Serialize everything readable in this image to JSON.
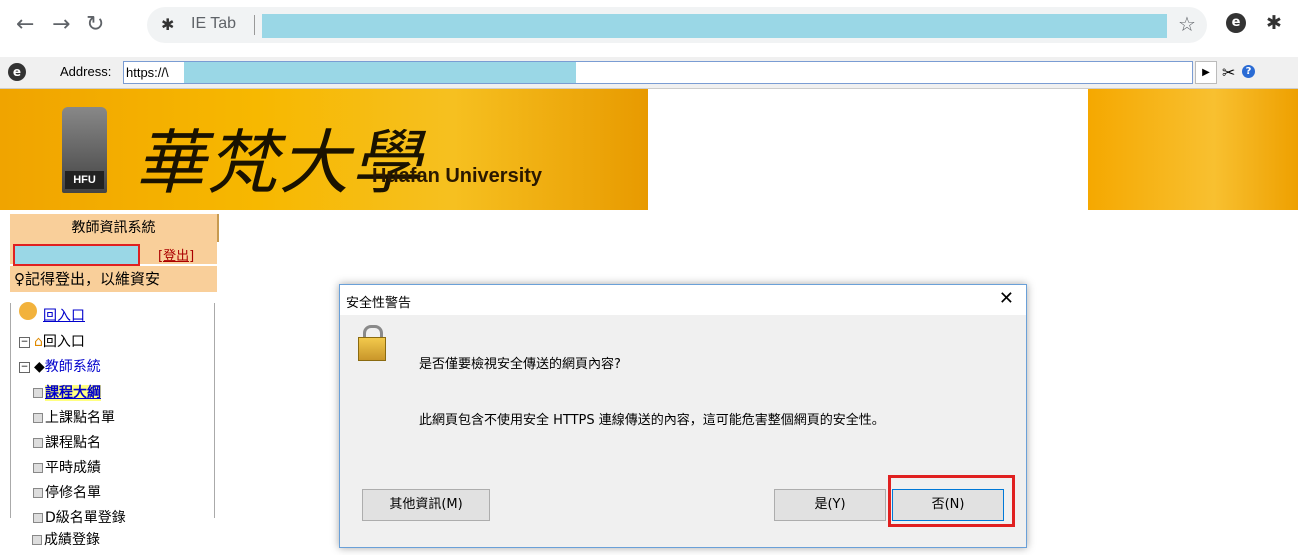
{
  "browser": {
    "tab_label": "IE Tab",
    "address_label": "Address:",
    "address_value": "https://\\",
    "ie_logo": "e"
  },
  "banner": {
    "chinese_name": "華梵大學",
    "english_name": "Huafan University",
    "emblem_text": "HFU"
  },
  "sidebar": {
    "header": "教師資訊系統",
    "logout": "[登出]",
    "tip": "♀記得登出，以維資安",
    "home_link": "回入口",
    "items": [
      {
        "label": "回入口"
      },
      {
        "label": "教師系統"
      },
      {
        "label": "課程大綱"
      },
      {
        "label": "上課點名單"
      },
      {
        "label": "課程點名"
      },
      {
        "label": "平時成績"
      },
      {
        "label": "停修名單"
      },
      {
        "label": "D級名單登錄"
      },
      {
        "label": "成績登錄"
      }
    ]
  },
  "dialog": {
    "title": "安全性警告",
    "close": "✕",
    "question": "是否僅要檢視安全傳送的網頁內容?",
    "message": "此網頁包含不使用安全 HTTPS 連線傳送的內容，這可能危害整個網頁的安全性。",
    "more_info_button": "其他資訊(M)",
    "yes_button": "是(Y)",
    "no_button": "否(N)"
  },
  "colors": {
    "banner": "#f7b800",
    "redact": "#9ad7e6",
    "highlight": "#e02020"
  }
}
